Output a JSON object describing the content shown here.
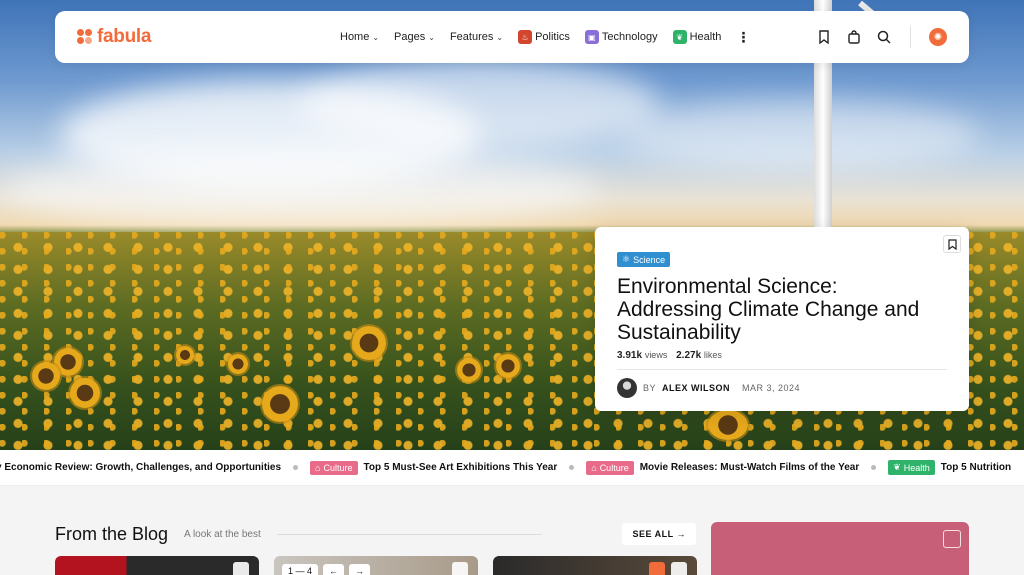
{
  "brand": {
    "name": "fabula",
    "accent": "#f26b3a"
  },
  "nav": {
    "items": [
      {
        "label": "Home",
        "has_dropdown": true
      },
      {
        "label": "Pages",
        "has_dropdown": true
      },
      {
        "label": "Features",
        "has_dropdown": true
      }
    ],
    "categories": [
      {
        "label": "Politics",
        "icon": "flame-icon",
        "color": "#d2462e"
      },
      {
        "label": "Technology",
        "icon": "chip-icon",
        "color": "#8a6fd8"
      },
      {
        "label": "Health",
        "icon": "leaf-icon",
        "color": "#2fb36b"
      }
    ],
    "right_icons": [
      "bookmark-icon",
      "cart-icon",
      "search-icon",
      "avatar"
    ]
  },
  "feature": {
    "tag": "Science",
    "tag_color": "#2f8fd0",
    "title": "Environmental Science: Addressing Climate Change and Sustainability",
    "views_value": "3.91k",
    "views_label": "views",
    "likes_value": "2.27k",
    "likes_label": "likes",
    "author_prefix": "BY",
    "author": "ALEX WILSON",
    "date": "MAR 3, 2024"
  },
  "ticker": [
    {
      "badge": "",
      "title": "y Economic Review: Growth, Challenges, and Opportunities"
    },
    {
      "badge": "Culture",
      "color": "#e86b8a",
      "title": "Top 5 Must-See Art Exhibitions This Year"
    },
    {
      "badge": "Culture",
      "color": "#e86b8a",
      "title": "Movie Releases: Must-Watch Films of the Year"
    },
    {
      "badge": "Health",
      "color": "#2fb36b",
      "title": "Top 5 Nutrition"
    }
  ],
  "blog": {
    "title": "From the Blog",
    "subtitle": "A look at the best",
    "see_all": "SEE ALL →",
    "pager": {
      "range": "1 — 4",
      "prev": "←",
      "next": "→"
    }
  }
}
